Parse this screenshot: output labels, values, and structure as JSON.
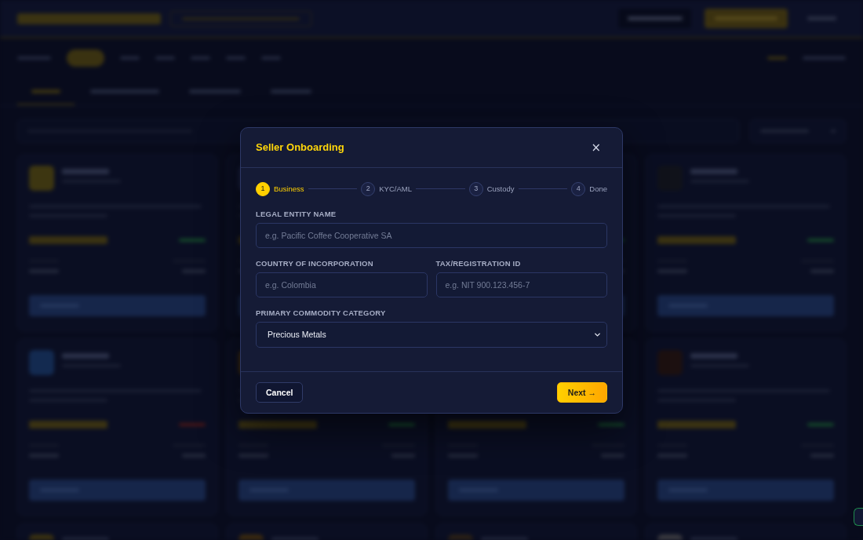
{
  "dialog": {
    "title": "Seller Onboarding",
    "close_label": "×"
  },
  "steps": [
    {
      "number": "1",
      "label": "Business",
      "active": true
    },
    {
      "number": "2",
      "label": "KYC/AML",
      "active": false
    },
    {
      "number": "3",
      "label": "Custody",
      "active": false
    },
    {
      "number": "4",
      "label": "Done",
      "active": false
    }
  ],
  "form": {
    "rows": [
      {
        "fields": [
          {
            "kind": "text",
            "label": "LEGAL ENTITY NAME",
            "placeholder": "e.g. Pacific Coffee Cooperative SA"
          }
        ]
      },
      {
        "fields": [
          {
            "kind": "text",
            "label": "COUNTRY OF INCORPORATION",
            "placeholder": "e.g. Colombia"
          },
          {
            "kind": "text",
            "label": "TAX/REGISTRATION ID",
            "placeholder": "e.g. NIT 900.123.456-7"
          }
        ]
      },
      {
        "fields": [
          {
            "kind": "select",
            "label": "PRIMARY COMMODITY CATEGORY",
            "value": "Precious Metals"
          }
        ]
      }
    ]
  },
  "buttons": [
    {
      "kind": "secondary",
      "label": "Cancel"
    },
    {
      "kind": "primary",
      "label": "Next →"
    }
  ]
}
